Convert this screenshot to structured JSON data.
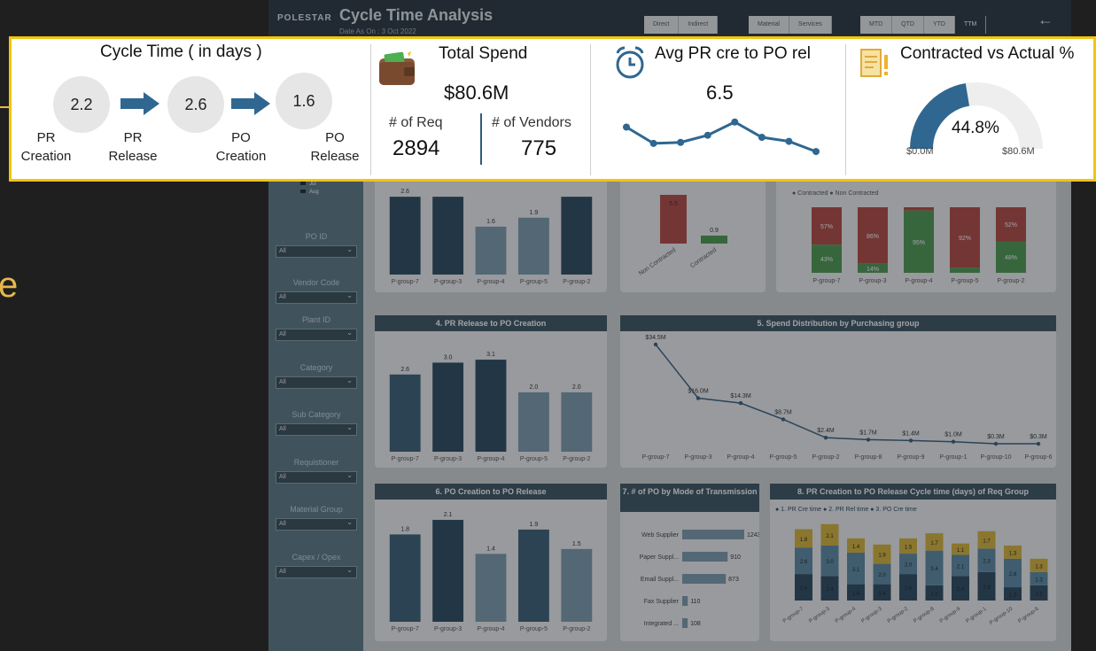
{
  "slide": {
    "side_letter": "e"
  },
  "dashboard": {
    "brand": "POLESTAR",
    "title": "Cycle Time Analysis",
    "date_label": "Date As On : 3 Oct 2022",
    "toggles_group1": [
      "Direct",
      "Indirect"
    ],
    "toggles_group2": [
      "Material",
      "Services"
    ],
    "toggles_group3": [
      "MTD",
      "QTD",
      "YTD",
      "TTM"
    ],
    "active_toggle": "TTM",
    "back_icon": "back-arrow-icon",
    "sidebar": {
      "legend": [
        "Jul",
        "Aug"
      ],
      "filters": [
        {
          "label": "PO ID",
          "value": "All"
        },
        {
          "label": "Vendor Code",
          "value": "All"
        },
        {
          "label": "Plant ID",
          "value": "All"
        },
        {
          "label": "Category",
          "value": "All"
        },
        {
          "label": "Sub Category",
          "value": "All"
        },
        {
          "label": "Requistioner",
          "value": "All"
        },
        {
          "label": "Material Group",
          "value": "All"
        },
        {
          "label": "Capex / Opex",
          "value": "All"
        }
      ]
    },
    "panels": {
      "p1": {
        "categories": [
          "P-group-7",
          "P-group-3",
          "P-group-4",
          "P-group-5",
          "P-group-2"
        ],
        "values": [
          2.6,
          2.6,
          1.6,
          1.9,
          2.6
        ],
        "labels": [
          "2.6",
          "",
          "1.6",
          "1.9",
          ""
        ]
      },
      "p2": {
        "categories": [
          "Non Contracted",
          "Contracted"
        ],
        "values": [
          5.5,
          0.9
        ],
        "labels": [
          "5.5",
          "0.9"
        ]
      },
      "p3": {
        "legend": [
          "Contracted",
          "Non Contracted"
        ],
        "categories": [
          "P-group-7",
          "P-group-3",
          "P-group-4",
          "P-group-5",
          "P-group-2"
        ],
        "non_contracted": [
          57,
          86,
          5,
          92,
          52
        ],
        "contracted": [
          43,
          14,
          95,
          8,
          48
        ],
        "nc_labels": [
          "57%",
          "86%",
          "",
          "92%",
          "52%"
        ],
        "c_labels": [
          "43%",
          "14%",
          "95%",
          "",
          "48%"
        ]
      },
      "p4": {
        "title": "4. PR Release to PO Creation",
        "categories": [
          "P-group-7",
          "P-group-3",
          "P-group-4",
          "P-group-5",
          "P-group-2"
        ],
        "values": [
          2.6,
          3.0,
          3.1,
          2.0,
          2.0
        ],
        "labels": [
          "2.6",
          "3.0",
          "3.1",
          "2.0",
          "2.0"
        ]
      },
      "p5": {
        "title": "5. Spend Distribution by Purchasing group",
        "categories": [
          "P-group-7",
          "P-group-3",
          "P-group-4",
          "P-group-5",
          "P-group-2",
          "P-group-8",
          "P-group-9",
          "P-group-1",
          "P-group-10",
          "P-group-6"
        ],
        "values": [
          34.5,
          16.0,
          14.3,
          8.7,
          2.4,
          1.7,
          1.4,
          1.0,
          0.3,
          0.3
        ],
        "labels": [
          "$34.5M",
          "$16.0M",
          "$14.3M",
          "$8.7M",
          "$2.4M",
          "$1.7M",
          "$1.4M",
          "$1.0M",
          "$0.3M",
          "$0.3M"
        ]
      },
      "p6": {
        "title": "6. PO Creation to PO Release",
        "categories": [
          "P-group-7",
          "P-group-3",
          "P-group-4",
          "P-group-5",
          "P-group-2"
        ],
        "values": [
          1.8,
          2.1,
          1.4,
          1.9,
          1.5
        ],
        "labels": [
          "1.8",
          "2.1",
          "1.4",
          "1.9",
          "1.5"
        ]
      },
      "p7": {
        "title": "7. # of PO by Mode of Transmission",
        "categories": [
          "Web Supplier",
          "Paper Suppl...",
          "Email Suppl...",
          "Fax Supplier",
          "Integrated ..."
        ],
        "values": [
          1243,
          910,
          873,
          110,
          108
        ],
        "labels": [
          "1243",
          "910",
          "873",
          "110",
          "108"
        ]
      },
      "p8": {
        "title": "8. PR Creation to PO Release Cycle time (days) of Req Group",
        "legend": [
          "1. PR Cre time",
          "2. PR Rel time",
          "3. PO Cre time"
        ],
        "categories": [
          "P-group-7",
          "P-group-3",
          "P-group-4",
          "P-group-3",
          "P-group-2",
          "P-group-8",
          "P-group-9",
          "P-group-1",
          "P-group-10",
          "P-group-6"
        ],
        "s1": [
          2.6,
          2.4,
          1.6,
          1.6,
          2.6,
          1.5,
          2.4,
          2.8,
          1.3,
          1.5
        ],
        "s2": [
          2.6,
          3.0,
          3.1,
          2.0,
          2.0,
          3.4,
          2.1,
          2.3,
          2.8,
          1.3
        ],
        "s3": [
          1.8,
          2.1,
          1.4,
          1.9,
          1.5,
          1.7,
          1.1,
          1.7,
          1.3,
          1.3
        ],
        "s1_labels": [
          "2.6",
          "2.4",
          "1.6",
          "1.6",
          "2.6",
          "1.5",
          "2.4",
          "2.8",
          "1.3",
          "1.5"
        ],
        "s2_labels": [
          "2.6",
          "3.0",
          "3.1",
          "2.0",
          "2.0",
          "3.4",
          "2.1",
          "2.3",
          "2.8",
          "1.3"
        ],
        "s3_labels": [
          "1.8",
          "2.1",
          "1.4",
          "1.9",
          "1.5",
          "1.7",
          "1.1",
          "1.7",
          "1.3",
          "1.3"
        ]
      }
    }
  },
  "kpi": {
    "cycle_time": {
      "title": "Cycle Time ( in days )",
      "values": [
        "2.2",
        "2.6",
        "1.6"
      ],
      "steps": [
        {
          "l1": "PR",
          "l2": "Creation"
        },
        {
          "l1": "PR",
          "l2": "Release"
        },
        {
          "l1": "PO",
          "l2": "Creation"
        },
        {
          "l1": "PO",
          "l2": "Release"
        }
      ]
    },
    "total_spend": {
      "title": "Total Spend",
      "value": "$80.6M",
      "req_label": "# of Req",
      "req_value": "2894",
      "vendors_label": "# of Vendors",
      "vendors_value": "775",
      "icon": "wallet-icon"
    },
    "avg_pr": {
      "title": "Avg PR cre to PO rel",
      "value": "6.5",
      "icon": "alarm-clock-icon",
      "trend": [
        8.0,
        6.4,
        6.5,
        7.2,
        8.5,
        7.0,
        6.6,
        5.6
      ]
    },
    "contracted": {
      "title": "Contracted vs Actual %",
      "value": "44.8%",
      "min_label": "$0.0M",
      "max_label": "$80.6M",
      "fraction": 0.448,
      "icon": "document-alert-icon"
    },
    "colors": {
      "accent": "#2f6791",
      "border": "#f2c40f",
      "gauge_track": "#eeeeee"
    }
  }
}
